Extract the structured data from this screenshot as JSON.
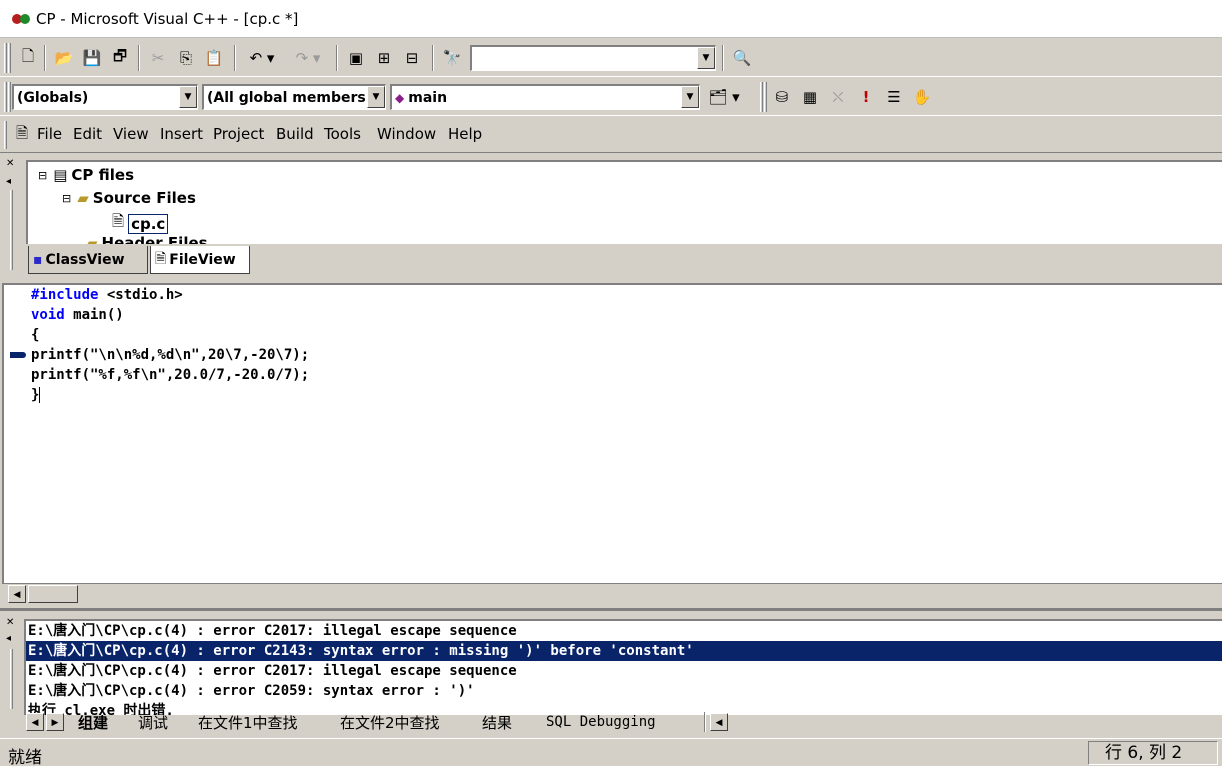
{
  "window": {
    "title": "CP - Microsoft Visual C++ - [cp.c *]"
  },
  "toolbar": {
    "find_combo_value": "",
    "icons": [
      "new-text-file-icon",
      "open-icon",
      "save-icon",
      "save-all-icon",
      "cut-icon",
      "copy-icon",
      "paste-icon",
      "undo-icon",
      "redo-icon",
      "workspace-icon",
      "output-icon",
      "window-list-icon",
      "find-in-files-icon",
      "search-icon"
    ]
  },
  "wizardbar": {
    "class_combo": "(Globals)",
    "filter_combo": "(All global members",
    "members_combo": "main",
    "icons": [
      "wizard-action-icon",
      "compile-icon",
      "build-icon",
      "stop-build-icon",
      "execute-icon",
      "insert-breakpoint-icon",
      "go-icon"
    ]
  },
  "menu": {
    "items": [
      "File",
      "Edit",
      "View",
      "Insert",
      "Project",
      "Build",
      "Tools",
      "Window",
      "Help"
    ]
  },
  "workspace": {
    "tree": {
      "root": "CP files",
      "folder": "Source Files",
      "file": "cp.c",
      "partial": "Header Files"
    },
    "tabs": [
      "ClassView",
      "FileView"
    ]
  },
  "editor": {
    "lines": [
      {
        "kw": "#include",
        "rest": " <stdio.h>"
      },
      {
        "kw": "void",
        "rest": " main()"
      },
      {
        "kw": "",
        "rest": "{"
      },
      {
        "kw": "",
        "rest": "printf(\"\\n\\n%d,%d\\n\",20\\7,-20\\7);"
      },
      {
        "kw": "",
        "rest": "printf(\"%f,%f\\n\",20.0/7,-20.0/7);"
      },
      {
        "kw": "",
        "rest": "}"
      }
    ]
  },
  "output": {
    "lines": [
      "E:\\唐入门\\CP\\cp.c(4) : error C2017: illegal escape sequence",
      "E:\\唐入门\\CP\\cp.c(4) : error C2143: syntax error : missing ')' before 'constant'",
      "E:\\唐入门\\CP\\cp.c(4) : error C2017: illegal escape sequence",
      "E:\\唐入门\\CP\\cp.c(4) : error C2059: syntax error : ')'",
      "执行 cl.exe 时出错."
    ],
    "selected_index": 1,
    "tabs": [
      "组建",
      "调试",
      "在文件1中查找",
      "在文件2中查找",
      "结果",
      "SQL Debugging"
    ]
  },
  "status": {
    "text": "就绪",
    "position": "行 6, 列 2"
  },
  "colors": {
    "face": "#d4d0c8",
    "selection": "#0a246a",
    "keyword": "#0000ff"
  }
}
